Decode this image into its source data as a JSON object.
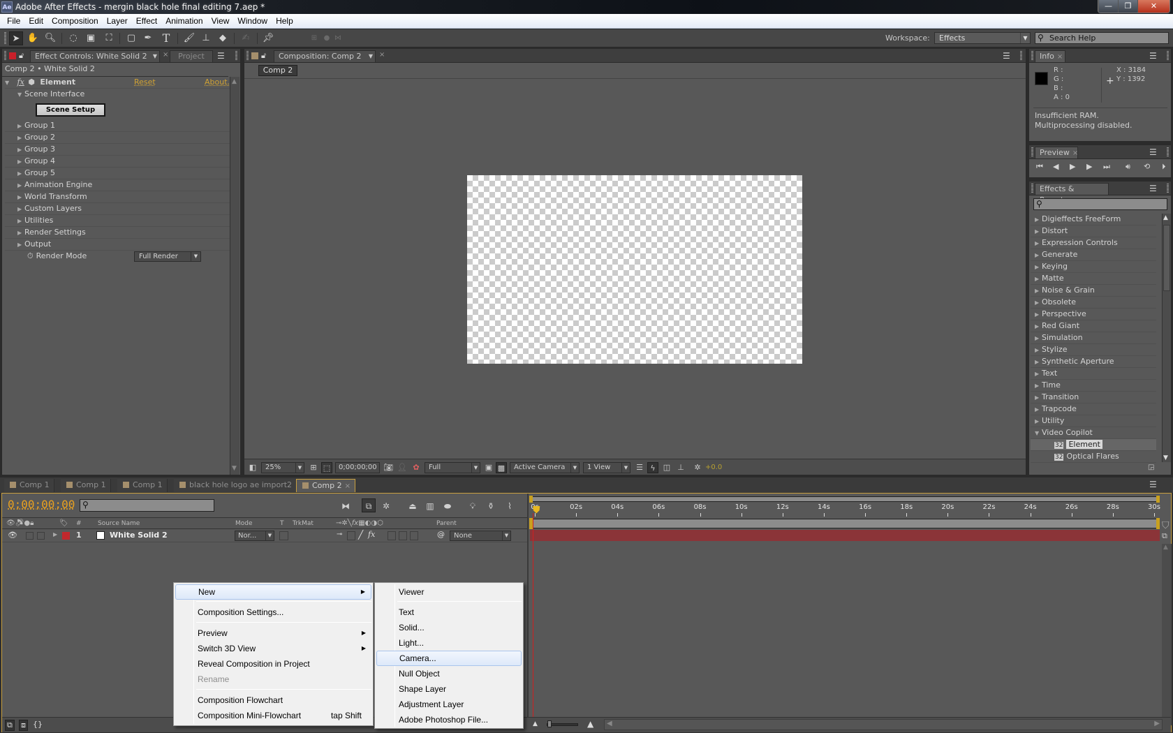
{
  "window": {
    "app_icon": "Ae",
    "title": "Adobe After Effects - mergin black hole final editing 7.aep *",
    "controls": {
      "minimize": "—",
      "maximize": "❐",
      "close": "✕"
    }
  },
  "menubar": [
    "File",
    "Edit",
    "Composition",
    "Layer",
    "Effect",
    "Animation",
    "View",
    "Window",
    "Help"
  ],
  "toolbar": {
    "tools": [
      "selection-tool",
      "hand-tool",
      "zoom-tool",
      "rotation-tool",
      "camera-tool",
      "pan-behind-tool",
      "rectangle-tool",
      "pen-tool",
      "type-tool",
      "brush-tool",
      "clone-stamp-tool",
      "eraser-tool",
      "roto-brush-tool",
      "puppet-pin-tool"
    ],
    "workspace_label": "Workspace:",
    "workspace_value": "Effects",
    "search_placeholder": "Search Help"
  },
  "effect_controls": {
    "tab_label": "Effect Controls: White Solid 2",
    "project_tab": "Project",
    "breadcrumb": "Comp 2 • White Solid 2",
    "effect_name": "Element",
    "reset_label": "Reset",
    "about_label": "About...",
    "scene_interface": "Scene Interface",
    "scene_setup_button": "Scene Setup",
    "groups": [
      "Group 1",
      "Group 2",
      "Group 3",
      "Group 4",
      "Group 5",
      "Animation Engine",
      "World Transform",
      "Custom Layers",
      "Utilities",
      "Render Settings",
      "Output"
    ],
    "render_mode_label": "Render Mode",
    "render_mode_value": "Full Render"
  },
  "composition": {
    "tab_label": "Composition: Comp 2",
    "comp_button": "Comp 2",
    "zoom": "25%",
    "timecode": "0;00;00;00",
    "resolution": "Full",
    "camera": "Active Camera",
    "views": "1 View",
    "exposure": "+0.0"
  },
  "info": {
    "tab_label": "Info",
    "r_label": "R :",
    "g_label": "G :",
    "b_label": "B :",
    "a_label": "A : 0",
    "x_label": "X : 3184",
    "y_label": "Y : 1392",
    "message_1": "Insufficient RAM.",
    "message_2": "Multiprocessing disabled.",
    "swatch_color": "#000000"
  },
  "preview": {
    "tab_label": "Preview",
    "buttons": [
      "first-frame",
      "previous-frame",
      "play",
      "next-frame",
      "last-frame",
      "audio",
      "loop",
      "ram-preview"
    ]
  },
  "effects_presets": {
    "tab_label": "Effects & Presets",
    "search_value": "",
    "categories": [
      "Digieffects FreeForm",
      "Distort",
      "Expression Controls",
      "Generate",
      "Keying",
      "Matte",
      "Noise & Grain",
      "Obsolete",
      "Perspective",
      "Red Giant",
      "Simulation",
      "Stylize",
      "Synthetic Aperture",
      "Text",
      "Time",
      "Transition",
      "Trapcode",
      "Utility"
    ],
    "expanded_category": "Video Copilot",
    "expanded_items": [
      "Element",
      "Optical Flares"
    ],
    "selected_item": "Element"
  },
  "timeline": {
    "tabs": [
      "Comp 1",
      "Comp 1",
      "Comp 1",
      "black hole logo ae import2",
      "Comp 2"
    ],
    "active_tab": "Comp 2",
    "timecode": "0;00;00;00",
    "search_value": "",
    "columns": {
      "num": "#",
      "source_name": "Source Name",
      "mode": "Mode",
      "t": "T",
      "trkmat": "TrkMat",
      "parent": "Parent"
    },
    "layers": [
      {
        "num": "1",
        "name": "White Solid 2",
        "mode": "Nor...",
        "parent": "None",
        "label_color": "#c0282d"
      }
    ],
    "ruler_ticks": [
      "0s",
      "02s",
      "04s",
      "06s",
      "08s",
      "10s",
      "12s",
      "14s",
      "16s",
      "18s",
      "20s",
      "22s",
      "24s",
      "26s",
      "28s",
      "30s"
    ],
    "layer_bar_color": "#8b3438",
    "accent_color": "#e8a020"
  },
  "context_menu": {
    "items": [
      {
        "label": "New",
        "submenu": true,
        "highlighted": true
      },
      {
        "sep": true
      },
      {
        "label": "Composition Settings..."
      },
      {
        "sep": true
      },
      {
        "label": "Preview",
        "submenu": true
      },
      {
        "label": "Switch 3D View",
        "submenu": true
      },
      {
        "label": "Reveal Composition in Project"
      },
      {
        "label": "Rename",
        "disabled": true
      },
      {
        "sep": true
      },
      {
        "label": "Composition Flowchart"
      },
      {
        "label": "Composition Mini-Flowchart",
        "shortcut": "tap Shift"
      }
    ],
    "submenu": [
      {
        "label": "Viewer"
      },
      {
        "sep": true
      },
      {
        "label": "Text"
      },
      {
        "label": "Solid..."
      },
      {
        "label": "Light..."
      },
      {
        "label": "Camera...",
        "highlighted": true
      },
      {
        "label": "Null Object"
      },
      {
        "label": "Shape Layer"
      },
      {
        "label": "Adjustment Layer"
      },
      {
        "label": "Adobe Photoshop File..."
      }
    ]
  }
}
